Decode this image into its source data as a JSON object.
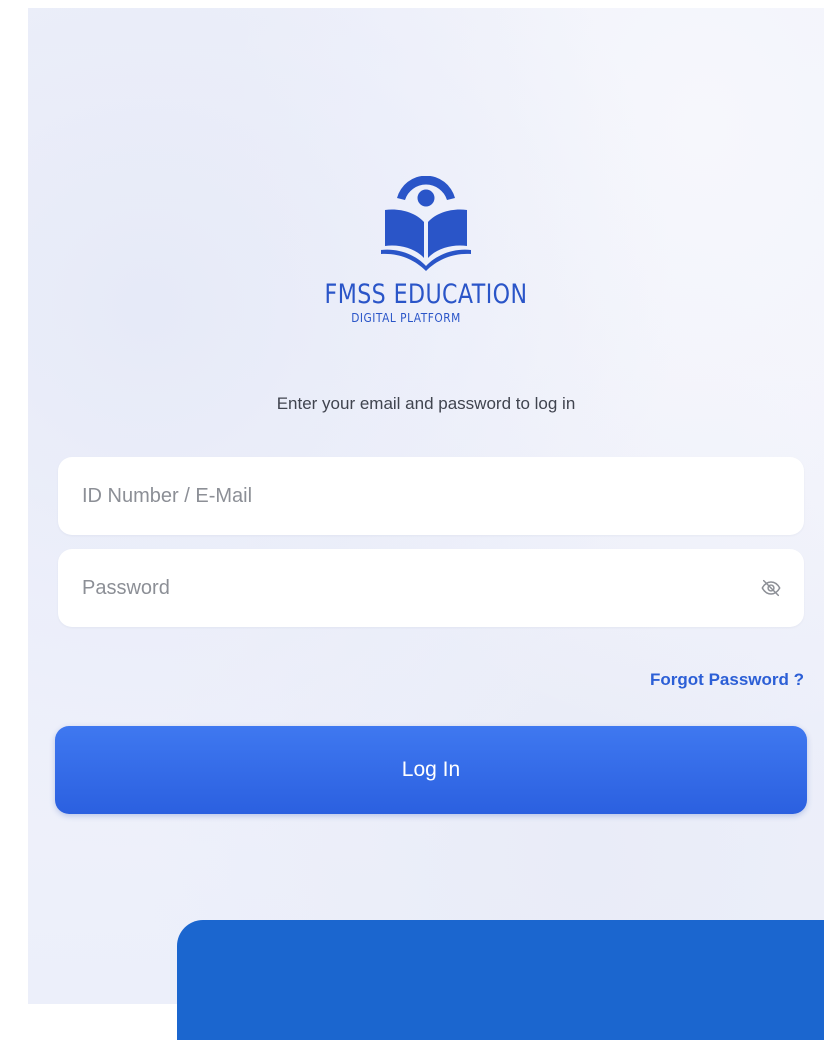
{
  "branding": {
    "title": "FMSS EDUCATION",
    "subtitle": "DIGITAL PLATFORM",
    "logo_icon": "reader-book-icon",
    "color": "#2a55c8"
  },
  "form": {
    "instructions": "Enter your email and password to log in",
    "email_placeholder": "ID Number / E-Mail",
    "email_value": "",
    "password_placeholder": "Password",
    "password_value": "",
    "password_toggle_icon": "eye-off-icon",
    "forgot_label": "Forgot Password ?",
    "login_label": "Log In"
  },
  "colors": {
    "accent": "#2c5fd6",
    "button": "#3169e6",
    "panel": "#1b66cf"
  }
}
